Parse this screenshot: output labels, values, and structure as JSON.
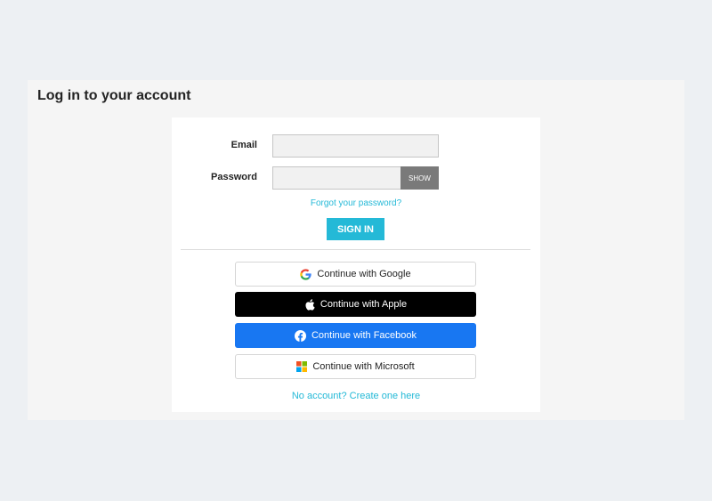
{
  "page": {
    "title": "Log in to your account"
  },
  "form": {
    "email_label": "Email",
    "email_value": "",
    "password_label": "Password",
    "password_value": "",
    "show_label": "SHOW",
    "forgot_label": "Forgot your password?",
    "signin_label": "SIGN IN"
  },
  "social": {
    "google_label": "Continue with Google",
    "apple_label": "Continue with Apple",
    "facebook_label": "Continue with Facebook",
    "microsoft_label": "Continue with Microsoft"
  },
  "create_account_label": "No account? Create one here",
  "icons": [
    "google-icon",
    "apple-icon",
    "facebook-icon",
    "microsoft-icon"
  ],
  "colors": {
    "accent": "#24b9d7",
    "facebook": "#1877f2",
    "apple": "#000000",
    "show_button": "#7a7a7a"
  }
}
